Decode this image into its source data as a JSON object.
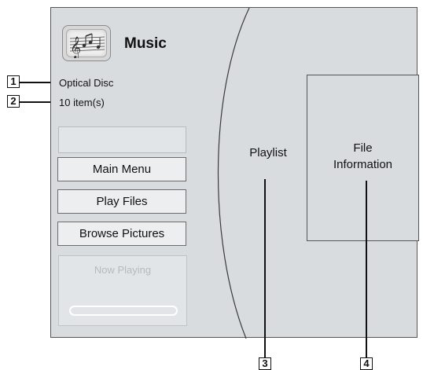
{
  "header": {
    "title": "Music",
    "icon": "music-notes-icon"
  },
  "info": {
    "source": "Optical Disc",
    "count": "10 item(s)"
  },
  "menu": {
    "items": [
      {
        "label": "Main Menu"
      },
      {
        "label": "Play Files"
      },
      {
        "label": "Browse Pictures"
      }
    ]
  },
  "now_playing": {
    "label": "Now Playing"
  },
  "panels": {
    "playlist": "Playlist",
    "file_information_line1": "File",
    "file_information_line2": "Information"
  },
  "callouts": [
    "1",
    "2",
    "3",
    "4"
  ],
  "colors": {
    "screen_bg": "#d9dcdf",
    "button_bg": "#eceef0",
    "border": "#555555"
  }
}
